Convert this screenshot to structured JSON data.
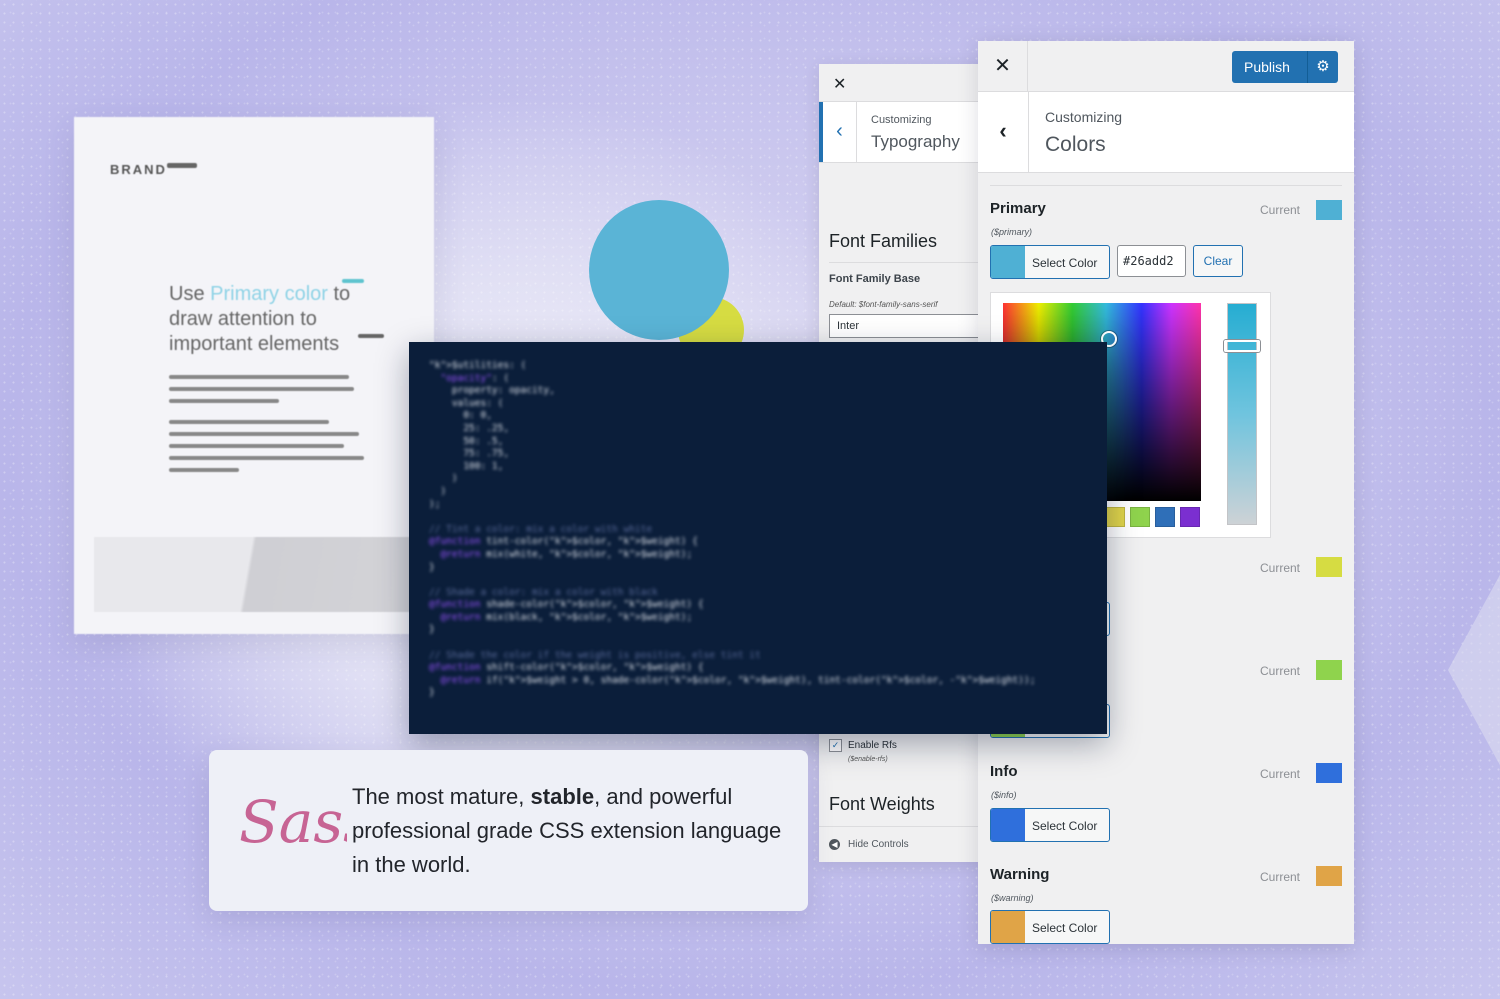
{
  "brand_preview": {
    "logo": "BRAND",
    "headline_pre": "Use ",
    "headline_highlight": "Primary color",
    "headline_post": " to draw attention to important elements"
  },
  "typography_panel": {
    "customizing": "Customizing",
    "title": "Typography",
    "font_families": "Font Families",
    "font_family_base": "Font Family Base",
    "default_note": "Default: $font-family-sans-serif",
    "font_value": "Inter",
    "enable_rfs": "Enable Rfs",
    "enable_rfs_var": "($enable-rfs)",
    "font_weights": "Font Weights",
    "hide_controls": "Hide Controls"
  },
  "colors_panel": {
    "publish_label": "Publish",
    "customizing": "Customizing",
    "title": "Colors",
    "current_label": "Current",
    "select_color_label": "Select Color",
    "clear_label": "Clear",
    "primary": {
      "name": "Primary",
      "var": "($primary)",
      "hex": "#26add2",
      "color": "#4fb0d4"
    },
    "success_color": "#d6dc42",
    "secondary_color": "#8fd34d",
    "info": {
      "name": "Info",
      "var": "($info)",
      "color": "#2f6fdc"
    },
    "warning": {
      "name": "Warning",
      "var": "($warning)",
      "color": "#e0a447"
    },
    "palette": [
      "#e0d44a",
      "#8fd34d",
      "#2f6fb8",
      "#7b2fd0"
    ]
  },
  "code_card": {
    "lines": [
      "$utilities: (",
      "  \"opacity\": (",
      "    property: opacity,",
      "    values: (",
      "      0: 0,",
      "      25: .25,",
      "      50: .5,",
      "      75: .75,",
      "      100: 1,",
      "    )",
      "  )",
      ");",
      "",
      "// Tint a color: mix a color with white",
      "@function tint-color($color, $weight) {",
      "  @return mix(white, $color, $weight);",
      "}",
      "",
      "// Shade a color: mix a color with black",
      "@function shade-color($color, $weight) {",
      "  @return mix(black, $color, $weight);",
      "}",
      "",
      "// Shade the color if the weight is positive, else tint it",
      "@function shift-color($color, $weight) {",
      "  @return if($weight > 0, shade-color($color, $weight), tint-color($color, -$weight));",
      "}"
    ]
  },
  "sass_card": {
    "logo_text": "Sass",
    "text_pre": "The most mature, ",
    "text_bold": "stable",
    "text_post": ", and powerful professional grade CSS extension language in the world."
  }
}
